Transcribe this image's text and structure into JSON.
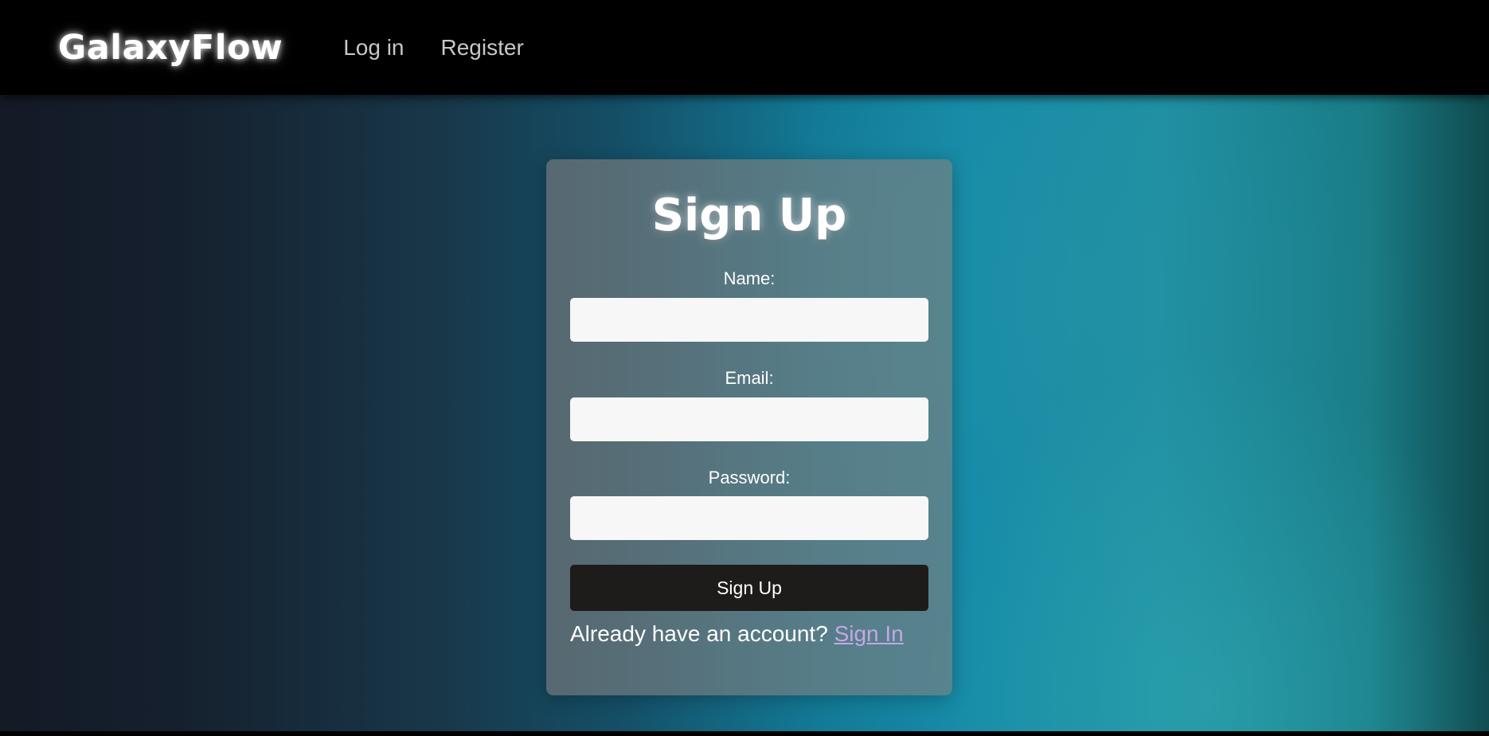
{
  "app": {
    "brand": "GalaxyFlow"
  },
  "nav": {
    "login_label": "Log in",
    "register_label": "Register"
  },
  "form": {
    "title": "Sign Up",
    "name_label": "Name:",
    "name_value": "",
    "email_label": "Email:",
    "email_value": "",
    "password_label": "Password:",
    "password_value": "",
    "submit_label": "Sign Up",
    "account_prompt": "Already have an account?",
    "signin_label": "Sign In"
  },
  "colors": {
    "navbar": "#000000",
    "card": "#6f7b80",
    "input_bg": "#f7f7f8",
    "button_bg": "#1e1b1b",
    "link": "#c5a6e6"
  }
}
